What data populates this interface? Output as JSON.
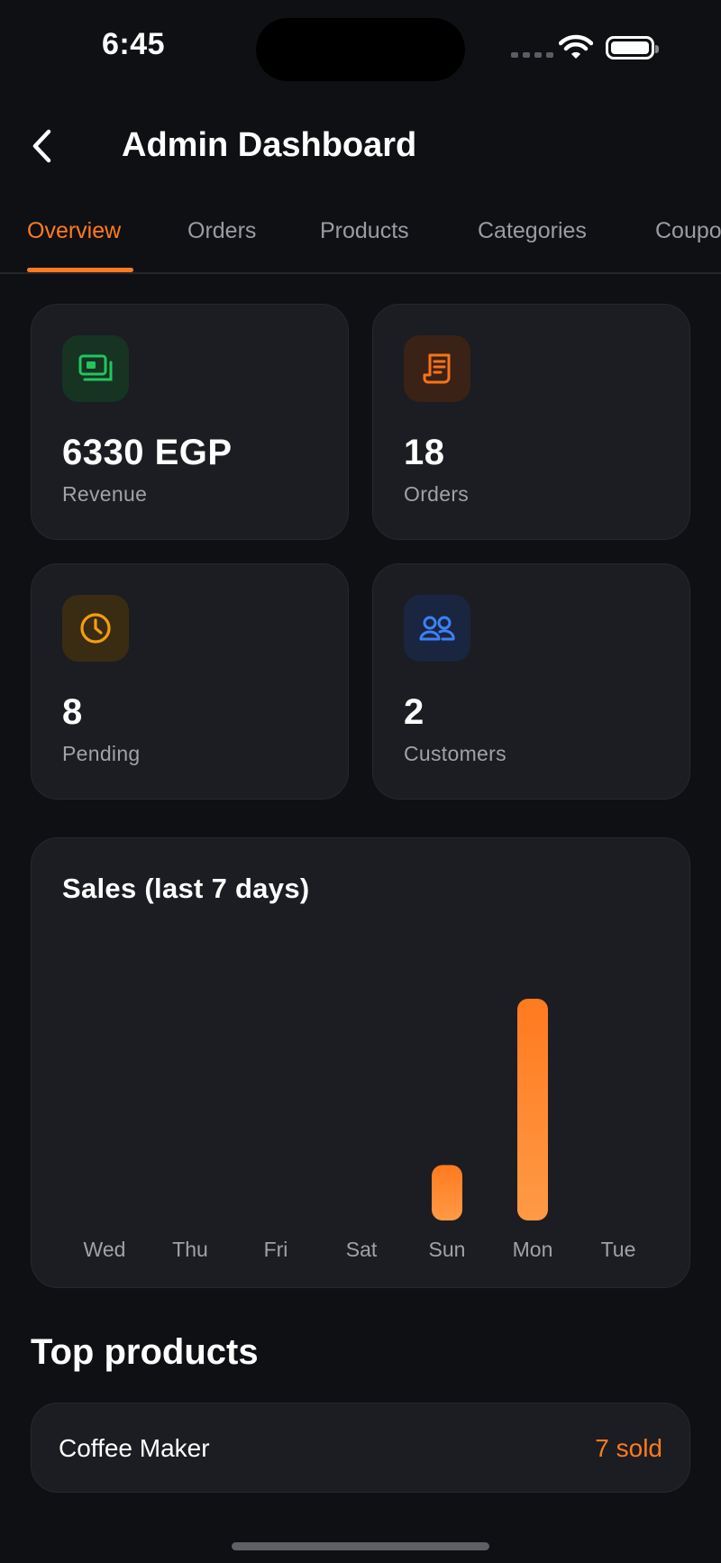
{
  "status_bar": {
    "time": "6:45"
  },
  "header": {
    "title": "Admin Dashboard"
  },
  "tabs": [
    {
      "label": "Overview"
    },
    {
      "label": "Orders"
    },
    {
      "label": "Products"
    },
    {
      "label": "Categories"
    },
    {
      "label": "Coupo"
    }
  ],
  "stats": [
    {
      "value": "6330 EGP",
      "label": "Revenue",
      "icon": "money-icon",
      "color": "#22c55e"
    },
    {
      "value": "18",
      "label": "Orders",
      "icon": "receipt-icon",
      "color": "#f97316"
    },
    {
      "value": "8",
      "label": "Pending",
      "icon": "clock-icon",
      "color": "#f59e0b"
    },
    {
      "value": "2",
      "label": "Customers",
      "icon": "users-icon",
      "color": "#3b82f6"
    }
  ],
  "chart": {
    "title": "Sales (last 7 days)"
  },
  "chart_data": {
    "type": "bar",
    "title": "Sales (last 7 days)",
    "categories": [
      "Wed",
      "Thu",
      "Fri",
      "Sat",
      "Sun",
      "Mon",
      "Tue"
    ],
    "values": [
      0,
      0,
      0,
      0,
      0.25,
      1,
      0
    ],
    "color": "#ff7a1f"
  },
  "top_products": {
    "title": "Top products",
    "items": [
      {
        "name": "Coffee Maker",
        "sold": "7 sold"
      }
    ]
  },
  "colors": {
    "accent": "#ff7a1f",
    "background": "#0f1014",
    "card": "#1b1d22"
  }
}
